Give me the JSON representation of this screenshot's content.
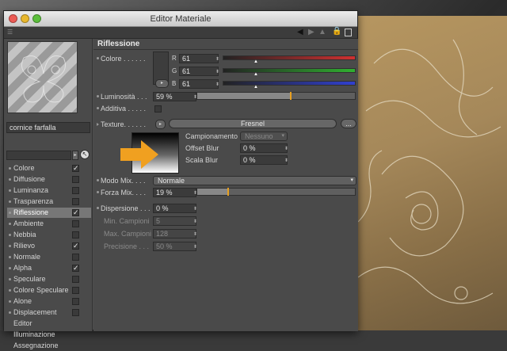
{
  "window": {
    "title": "Editor Materiale"
  },
  "material": {
    "name": "cornice farfalla"
  },
  "channels": [
    {
      "label": "Colore",
      "checked": true,
      "selected": false
    },
    {
      "label": "Diffusione",
      "checked": false,
      "selected": false
    },
    {
      "label": "Luminanza",
      "checked": false,
      "selected": false
    },
    {
      "label": "Trasparenza",
      "checked": false,
      "selected": false
    },
    {
      "label": "Riflessione",
      "checked": true,
      "selected": true
    },
    {
      "label": "Ambiente",
      "checked": false,
      "selected": false
    },
    {
      "label": "Nebbia",
      "checked": false,
      "selected": false
    },
    {
      "label": "Rilievo",
      "checked": true,
      "selected": false
    },
    {
      "label": "Normale",
      "checked": false,
      "selected": false
    },
    {
      "label": "Alpha",
      "checked": true,
      "selected": false
    },
    {
      "label": "Speculare",
      "checked": false,
      "selected": false
    },
    {
      "label": "Colore Speculare",
      "checked": false,
      "selected": false
    },
    {
      "label": "Alone",
      "checked": false,
      "selected": false
    },
    {
      "label": "Displacement",
      "checked": false,
      "selected": false
    },
    {
      "label": "Editor",
      "checked": null,
      "selected": false
    },
    {
      "label": "Illuminazione",
      "checked": null,
      "selected": false
    },
    {
      "label": "Assegnazione",
      "checked": null,
      "selected": false
    }
  ],
  "reflection": {
    "section_title": "Riflessione",
    "color_label": "Colore . . . . . .",
    "r_label": "R",
    "r_value": "61",
    "g_label": "G",
    "g_value": "61",
    "b_label": "B",
    "b_value": "61",
    "luminosity_label": "Luminosità . . .",
    "luminosity_value": "59 %",
    "luminosity_fraction": 0.59,
    "additive_label": "Additiva . . . . .",
    "texture_label": "Texture. . . . . .",
    "texture_name": "Fresnel",
    "texture_more": "...",
    "sampling_label": "Campionamento",
    "sampling_value": "Nessuno",
    "offset_blur_label": "Offset Blur",
    "offset_blur_value": "0 %",
    "scale_blur_label": "Scala Blur",
    "scale_blur_value": "0 %",
    "mix_mode_label": "Modo Mix. . . .",
    "mix_mode_value": "Normale",
    "mix_strength_label": "Forza Mix. . . .",
    "mix_strength_value": "19 %",
    "mix_strength_fraction": 0.19,
    "dispersion_label": "Dispersione . . .",
    "dispersion_value": "0 %",
    "min_samples_label": "Min. Campioni",
    "min_samples_value": "5",
    "max_samples_label": "Max. Campioni",
    "max_samples_value": "128",
    "precision_label": "Precisione . . .",
    "precision_value": "50 %"
  },
  "colors": {
    "r_bar": "#d03030",
    "g_bar": "#30b030",
    "b_bar": "#3040d0",
    "accent_orange": "#f0a020"
  }
}
